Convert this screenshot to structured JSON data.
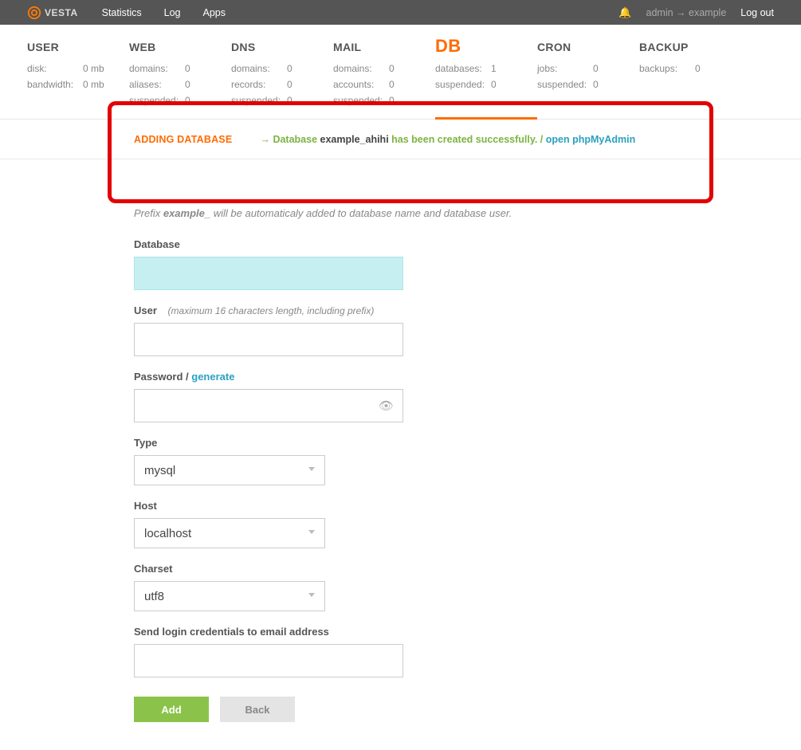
{
  "topbar": {
    "brand": "VESTA",
    "nav": {
      "statistics": "Statistics",
      "log": "Log",
      "apps": "Apps"
    },
    "crumb": "admin → example",
    "logout": "Log out"
  },
  "tabs": {
    "user": {
      "title": "USER",
      "rows": [
        [
          "disk:",
          "0 mb"
        ],
        [
          "bandwidth:",
          "0 mb"
        ]
      ]
    },
    "web": {
      "title": "WEB",
      "rows": [
        [
          "domains:",
          "0"
        ],
        [
          "aliases:",
          "0"
        ],
        [
          "suspended:",
          "0"
        ]
      ]
    },
    "dns": {
      "title": "DNS",
      "rows": [
        [
          "domains:",
          "0"
        ],
        [
          "records:",
          "0"
        ],
        [
          "suspended:",
          "0"
        ]
      ]
    },
    "mail": {
      "title": "MAIL",
      "rows": [
        [
          "domains:",
          "0"
        ],
        [
          "accounts:",
          "0"
        ],
        [
          "suspended:",
          "0"
        ]
      ]
    },
    "db": {
      "title": "DB",
      "rows": [
        [
          "databases:",
          "1"
        ],
        [
          "suspended:",
          "0"
        ]
      ]
    },
    "cron": {
      "title": "CRON",
      "rows": [
        [
          "jobs:",
          "0"
        ],
        [
          "suspended:",
          "0"
        ]
      ]
    },
    "backup": {
      "title": "BACKUP",
      "rows": [
        [
          "backups:",
          "0"
        ]
      ]
    }
  },
  "banner": {
    "title": "ADDING DATABASE",
    "arrow": "→ Database ",
    "dbname": "example_ahihi",
    "success": " has been created successfully. / ",
    "linktext": "open phpMyAdmin"
  },
  "prefix_note_a": "Prefix ",
  "prefix_note_b": "example_",
  "prefix_note_c": " will be automaticaly added to database name and database user.",
  "form": {
    "database_label": "Database",
    "user_label": "User",
    "user_hint": "(maximum 16 characters length, including prefix)",
    "password_label": "Password / ",
    "generate": "generate",
    "type_label": "Type",
    "type_value": "mysql",
    "host_label": "Host",
    "host_value": "localhost",
    "charset_label": "Charset",
    "charset_value": "utf8",
    "email_label": "Send login credentials to email address",
    "add": "Add",
    "back": "Back"
  }
}
